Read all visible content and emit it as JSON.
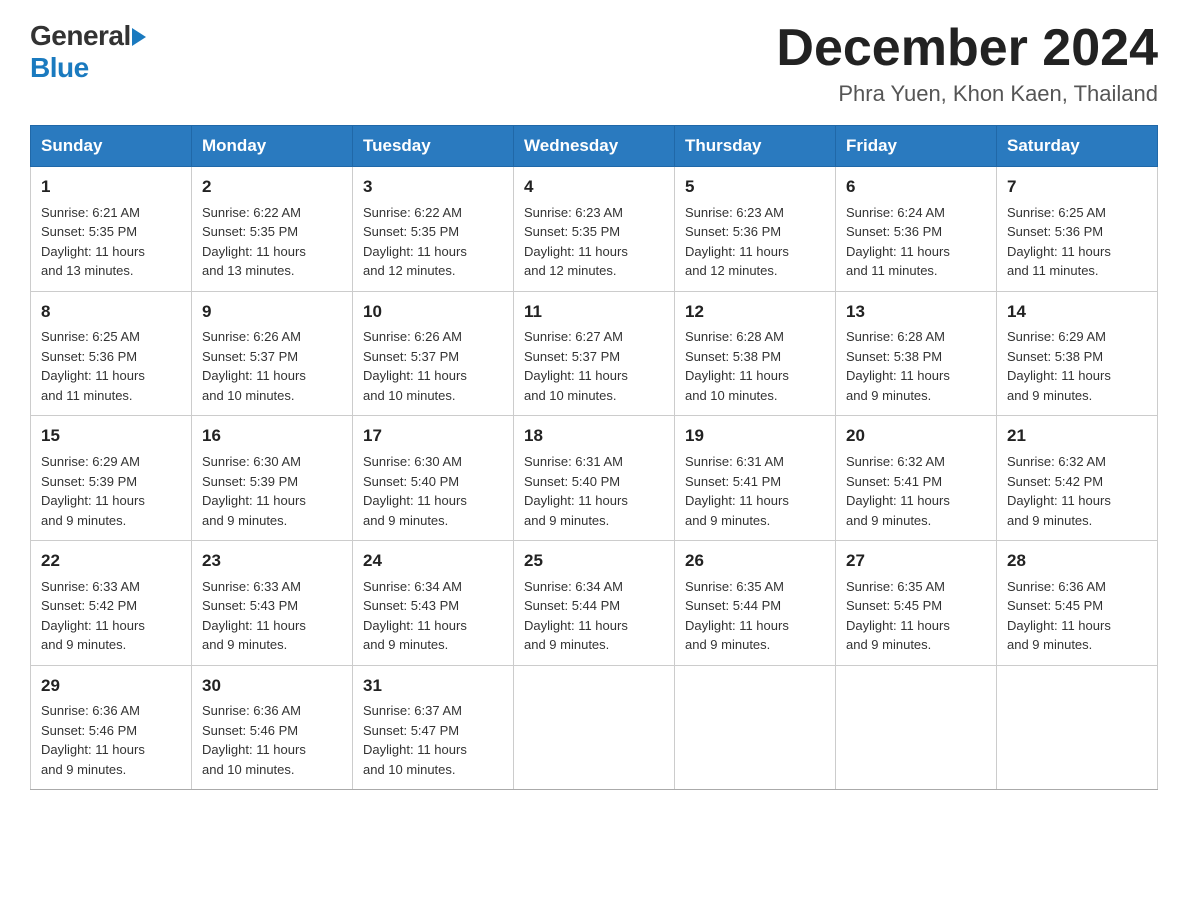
{
  "header": {
    "logo_general": "General",
    "logo_blue": "Blue",
    "month_title": "December 2024",
    "location": "Phra Yuen, Khon Kaen, Thailand"
  },
  "weekdays": [
    "Sunday",
    "Monday",
    "Tuesday",
    "Wednesday",
    "Thursday",
    "Friday",
    "Saturday"
  ],
  "weeks": [
    [
      {
        "day": "1",
        "sunrise": "6:21 AM",
        "sunset": "5:35 PM",
        "daylight": "11 hours and 13 minutes."
      },
      {
        "day": "2",
        "sunrise": "6:22 AM",
        "sunset": "5:35 PM",
        "daylight": "11 hours and 13 minutes."
      },
      {
        "day": "3",
        "sunrise": "6:22 AM",
        "sunset": "5:35 PM",
        "daylight": "11 hours and 12 minutes."
      },
      {
        "day": "4",
        "sunrise": "6:23 AM",
        "sunset": "5:35 PM",
        "daylight": "11 hours and 12 minutes."
      },
      {
        "day": "5",
        "sunrise": "6:23 AM",
        "sunset": "5:36 PM",
        "daylight": "11 hours and 12 minutes."
      },
      {
        "day": "6",
        "sunrise": "6:24 AM",
        "sunset": "5:36 PM",
        "daylight": "11 hours and 11 minutes."
      },
      {
        "day": "7",
        "sunrise": "6:25 AM",
        "sunset": "5:36 PM",
        "daylight": "11 hours and 11 minutes."
      }
    ],
    [
      {
        "day": "8",
        "sunrise": "6:25 AM",
        "sunset": "5:36 PM",
        "daylight": "11 hours and 11 minutes."
      },
      {
        "day": "9",
        "sunrise": "6:26 AM",
        "sunset": "5:37 PM",
        "daylight": "11 hours and 10 minutes."
      },
      {
        "day": "10",
        "sunrise": "6:26 AM",
        "sunset": "5:37 PM",
        "daylight": "11 hours and 10 minutes."
      },
      {
        "day": "11",
        "sunrise": "6:27 AM",
        "sunset": "5:37 PM",
        "daylight": "11 hours and 10 minutes."
      },
      {
        "day": "12",
        "sunrise": "6:28 AM",
        "sunset": "5:38 PM",
        "daylight": "11 hours and 10 minutes."
      },
      {
        "day": "13",
        "sunrise": "6:28 AM",
        "sunset": "5:38 PM",
        "daylight": "11 hours and 9 minutes."
      },
      {
        "day": "14",
        "sunrise": "6:29 AM",
        "sunset": "5:38 PM",
        "daylight": "11 hours and 9 minutes."
      }
    ],
    [
      {
        "day": "15",
        "sunrise": "6:29 AM",
        "sunset": "5:39 PM",
        "daylight": "11 hours and 9 minutes."
      },
      {
        "day": "16",
        "sunrise": "6:30 AM",
        "sunset": "5:39 PM",
        "daylight": "11 hours and 9 minutes."
      },
      {
        "day": "17",
        "sunrise": "6:30 AM",
        "sunset": "5:40 PM",
        "daylight": "11 hours and 9 minutes."
      },
      {
        "day": "18",
        "sunrise": "6:31 AM",
        "sunset": "5:40 PM",
        "daylight": "11 hours and 9 minutes."
      },
      {
        "day": "19",
        "sunrise": "6:31 AM",
        "sunset": "5:41 PM",
        "daylight": "11 hours and 9 minutes."
      },
      {
        "day": "20",
        "sunrise": "6:32 AM",
        "sunset": "5:41 PM",
        "daylight": "11 hours and 9 minutes."
      },
      {
        "day": "21",
        "sunrise": "6:32 AM",
        "sunset": "5:42 PM",
        "daylight": "11 hours and 9 minutes."
      }
    ],
    [
      {
        "day": "22",
        "sunrise": "6:33 AM",
        "sunset": "5:42 PM",
        "daylight": "11 hours and 9 minutes."
      },
      {
        "day": "23",
        "sunrise": "6:33 AM",
        "sunset": "5:43 PM",
        "daylight": "11 hours and 9 minutes."
      },
      {
        "day": "24",
        "sunrise": "6:34 AM",
        "sunset": "5:43 PM",
        "daylight": "11 hours and 9 minutes."
      },
      {
        "day": "25",
        "sunrise": "6:34 AM",
        "sunset": "5:44 PM",
        "daylight": "11 hours and 9 minutes."
      },
      {
        "day": "26",
        "sunrise": "6:35 AM",
        "sunset": "5:44 PM",
        "daylight": "11 hours and 9 minutes."
      },
      {
        "day": "27",
        "sunrise": "6:35 AM",
        "sunset": "5:45 PM",
        "daylight": "11 hours and 9 minutes."
      },
      {
        "day": "28",
        "sunrise": "6:36 AM",
        "sunset": "5:45 PM",
        "daylight": "11 hours and 9 minutes."
      }
    ],
    [
      {
        "day": "29",
        "sunrise": "6:36 AM",
        "sunset": "5:46 PM",
        "daylight": "11 hours and 9 minutes."
      },
      {
        "day": "30",
        "sunrise": "6:36 AM",
        "sunset": "5:46 PM",
        "daylight": "11 hours and 10 minutes."
      },
      {
        "day": "31",
        "sunrise": "6:37 AM",
        "sunset": "5:47 PM",
        "daylight": "11 hours and 10 minutes."
      },
      null,
      null,
      null,
      null
    ]
  ],
  "sunrise_label": "Sunrise:",
  "sunset_label": "Sunset:",
  "daylight_label": "Daylight:"
}
